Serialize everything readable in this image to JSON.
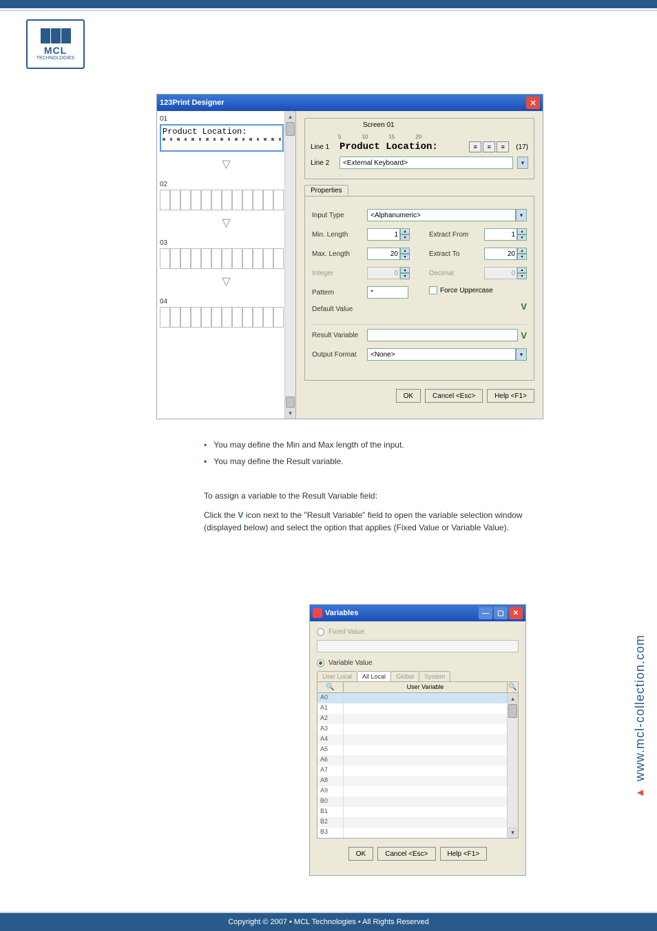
{
  "logo": {
    "text": "MCL",
    "sub": "TECHNOLOGIES"
  },
  "shot1": {
    "title": "123Print Designer",
    "screens": {
      "s1": "01",
      "s2": "02",
      "s3": "03",
      "s4": "04",
      "s1_text": "Product Location:"
    },
    "screen_legend": "Screen 01",
    "ruler": {
      "r5": "5",
      "r10": "10",
      "r15": "15",
      "r20": "20"
    },
    "line1_label": "Line 1",
    "line1_text": "Product Location:",
    "line1_count": "(17)",
    "line2_label": "Line 2",
    "line2_value": "<External Keyboard>",
    "prop_tab": "Properties",
    "labels": {
      "input_type": "Input Type",
      "min_len": "Min. Length",
      "max_len": "Max. Length",
      "integer": "Integer",
      "pattern": "Pattern",
      "default_value": "Default Value",
      "extract_from": "Extract From",
      "extract_to": "Extract To",
      "decimal": "Decimal",
      "force_upper": "Force Uppercase",
      "result_var": "Result Variable",
      "output_fmt": "Output Format"
    },
    "values": {
      "input_type": "<Alphanumeric>",
      "min_len": "1",
      "max_len": "20",
      "integer": "0",
      "pattern": "*",
      "extract_from": "1",
      "extract_to": "20",
      "decimal": "0",
      "output_fmt": "<None>"
    },
    "buttons": {
      "ok": "OK",
      "cancel": "Cancel <Esc>",
      "help": "Help <F1>"
    }
  },
  "bodytext": {
    "b1": "You may define the Min and Max length of the input.",
    "b2": "You may define the Result variable.",
    "t2a": "To assign a variable to the Result Variable field:",
    "t2b_pre": "Click the ",
    "t2b_post": " icon next to the \"Result Variable\" field to open the variable selection window (displayed below) and select the option that applies (Fixed Value or Variable Value)."
  },
  "shot2": {
    "title": "Variables",
    "fixed": "Fixed Value",
    "variable": "Variable Value",
    "tabs": {
      "t1": "User Local",
      "t2": "All Local",
      "t3": "Global",
      "t4": "System"
    },
    "header": "User Variable",
    "rows": [
      "A0",
      "A1",
      "A2",
      "A3",
      "A4",
      "A5",
      "A6",
      "A7",
      "A8",
      "A9",
      "B0",
      "B1",
      "B2",
      "B3"
    ],
    "buttons": {
      "ok": "OK",
      "cancel": "Cancel <Esc>",
      "help": "Help <F1>"
    }
  },
  "side_url": "www.mcl-collection.com",
  "footer": "Copyright © 2007 • MCL Technologies • All Rights Reserved"
}
